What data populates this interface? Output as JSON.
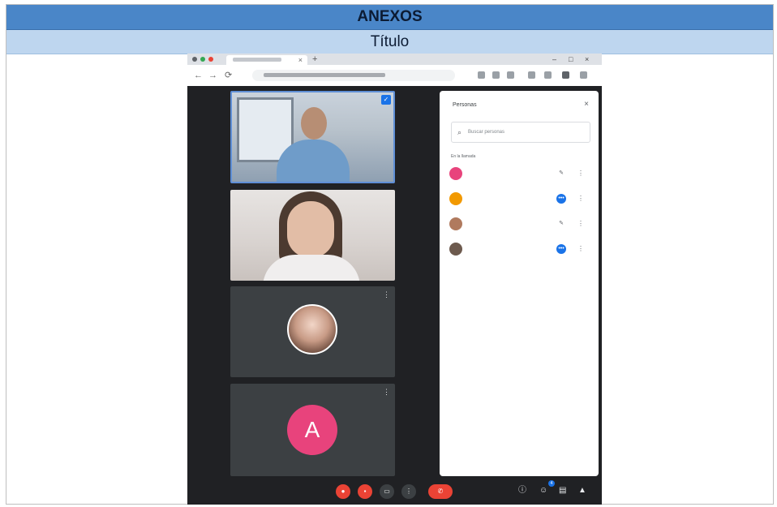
{
  "document": {
    "annex_heading": "ANEXOS",
    "title": "Título"
  },
  "browser": {
    "tab_close": "×",
    "new_tab": "+",
    "window_controls": [
      "–",
      "□",
      "×"
    ],
    "nav_buttons": [
      "←",
      "→",
      "⟳"
    ]
  },
  "meet": {
    "tiles": [
      {
        "type": "video",
        "name": "",
        "pinned": true
      },
      {
        "type": "video",
        "name": ""
      },
      {
        "type": "photo-avatar",
        "name": "",
        "menu": "⋮"
      },
      {
        "type": "letter-avatar",
        "letter": "A",
        "name": "",
        "menu": "⋮",
        "color": "#e8437c"
      }
    ],
    "people_panel": {
      "title": "Personas",
      "close": "×",
      "search_placeholder": "Buscar personas",
      "section_label": "En la llamada",
      "participants": [
        {
          "name": "",
          "subtitle": "",
          "avatar_color": "#e8437c",
          "indicator": "mic-off",
          "active": false
        },
        {
          "name": "",
          "subtitle": "",
          "avatar_color": "#f29900",
          "indicator": "speaking",
          "active": true
        },
        {
          "name": "",
          "subtitle": "",
          "avatar_color": "#b07a5e",
          "indicator": "mic-off",
          "active": false
        },
        {
          "name": "",
          "subtitle": "",
          "avatar_color": "#6d5a4e",
          "indicator": "speaking",
          "active": true
        }
      ]
    },
    "toolbar": {
      "meeting_label": "",
      "buttons": [
        "mic",
        "camera",
        "captions",
        "present",
        "more"
      ],
      "people_count": "4"
    }
  },
  "colors": {
    "header_blue": "#4a86c8",
    "title_blue": "#bed6ef",
    "meet_dark": "#202124",
    "end_call_red": "#ea4335",
    "accent_blue": "#1a73e8"
  }
}
